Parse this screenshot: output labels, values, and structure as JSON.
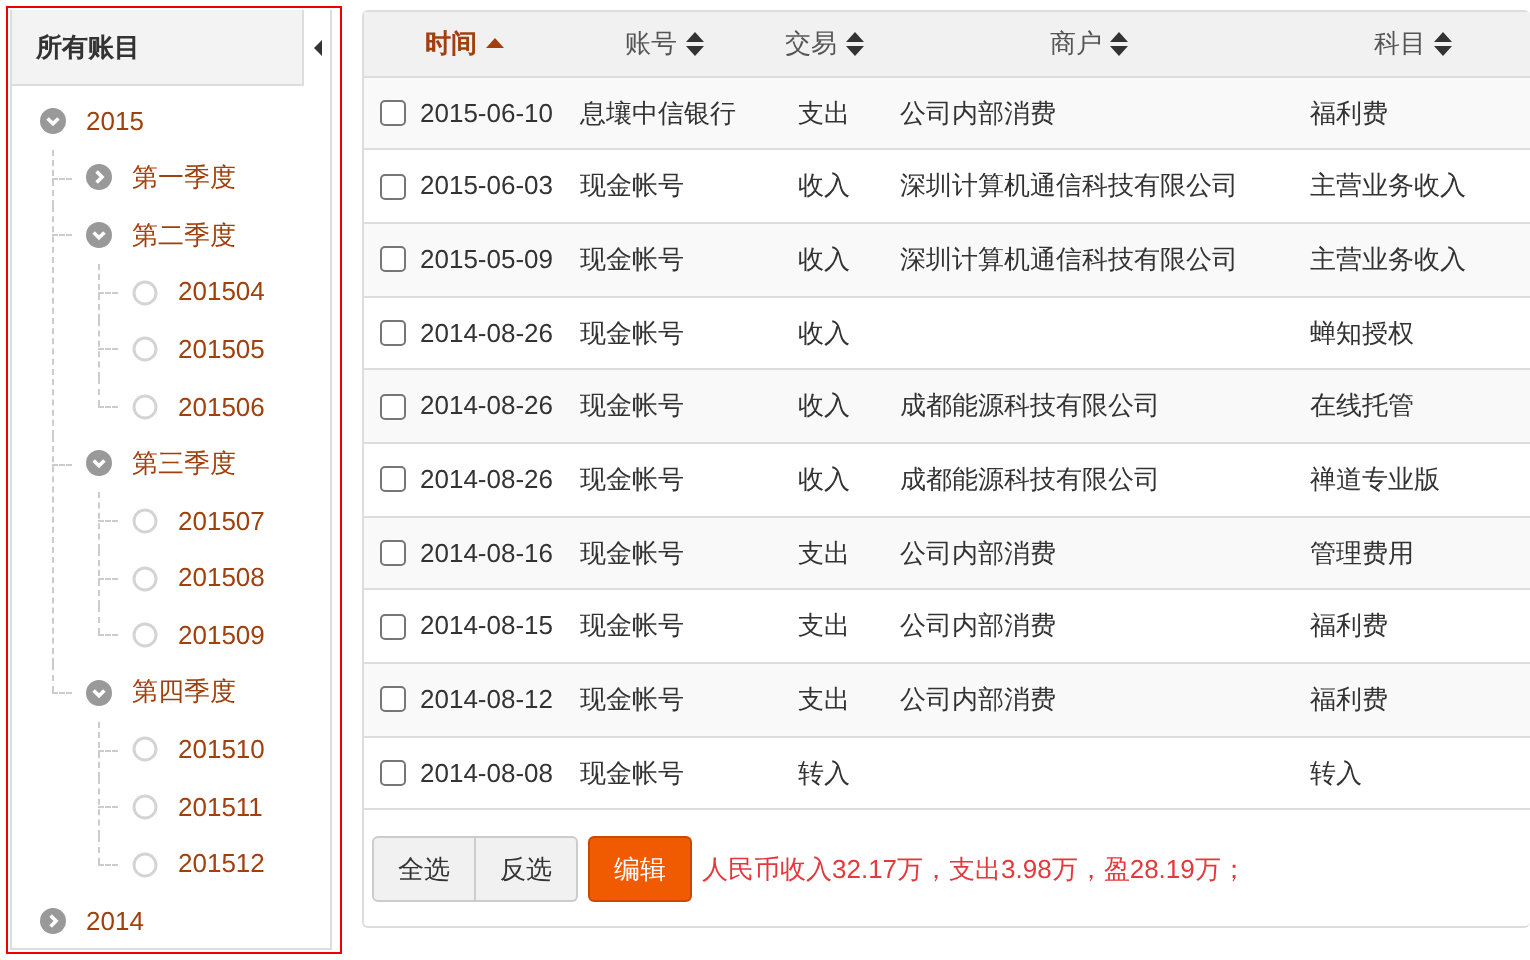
{
  "sidebar": {
    "title": "所有账目",
    "tree": [
      {
        "label": "2015",
        "expanded": true,
        "children": [
          {
            "label": "第一季度",
            "expanded": false
          },
          {
            "label": "第二季度",
            "expanded": true,
            "children": [
              {
                "label": "201504"
              },
              {
                "label": "201505"
              },
              {
                "label": "201506"
              }
            ]
          },
          {
            "label": "第三季度",
            "expanded": true,
            "children": [
              {
                "label": "201507"
              },
              {
                "label": "201508"
              },
              {
                "label": "201509"
              }
            ]
          },
          {
            "label": "第四季度",
            "expanded": true,
            "children": [
              {
                "label": "201510"
              },
              {
                "label": "201511"
              },
              {
                "label": "201512"
              }
            ]
          }
        ]
      },
      {
        "label": "2014",
        "expanded": false
      }
    ]
  },
  "table": {
    "columns": [
      {
        "label": "时间",
        "sorted": true
      },
      {
        "label": "账号",
        "sorted": false
      },
      {
        "label": "交易",
        "sorted": false
      },
      {
        "label": "商户",
        "sorted": false
      },
      {
        "label": "科目",
        "sorted": false
      }
    ],
    "rows": [
      {
        "checked": false,
        "cells": [
          "2015-06-10",
          "息壤中信银行",
          "支出",
          "公司内部消费",
          "福利费"
        ]
      },
      {
        "checked": false,
        "cells": [
          "2015-06-03",
          "现金帐号",
          "收入",
          "深圳计算机通信科技有限公司",
          "主营业务收入"
        ]
      },
      {
        "checked": false,
        "cells": [
          "2015-05-09",
          "现金帐号",
          "收入",
          "深圳计算机通信科技有限公司",
          "主营业务收入"
        ]
      },
      {
        "checked": false,
        "cells": [
          "2014-08-26",
          "现金帐号",
          "收入",
          "",
          "蝉知授权"
        ]
      },
      {
        "checked": false,
        "cells": [
          "2014-08-26",
          "现金帐号",
          "收入",
          "成都能源科技有限公司",
          "在线托管"
        ]
      },
      {
        "checked": false,
        "cells": [
          "2014-08-26",
          "现金帐号",
          "收入",
          "成都能源科技有限公司",
          "禅道专业版"
        ]
      },
      {
        "checked": false,
        "cells": [
          "2014-08-16",
          "现金帐号",
          "支出",
          "公司内部消费",
          "管理费用"
        ]
      },
      {
        "checked": false,
        "cells": [
          "2014-08-15",
          "现金帐号",
          "支出",
          "公司内部消费",
          "福利费"
        ]
      },
      {
        "checked": false,
        "cells": [
          "2014-08-12",
          "现金帐号",
          "支出",
          "公司内部消费",
          "福利费"
        ]
      },
      {
        "checked": false,
        "cells": [
          "2014-08-08",
          "现金帐号",
          "转入",
          "",
          "转入"
        ]
      }
    ]
  },
  "footer": {
    "buttons": [
      "全选",
      "反选"
    ],
    "edit_button": "编辑",
    "summary": "人民币收入32.17万，支出3.98万，盈28.19万；"
  }
}
